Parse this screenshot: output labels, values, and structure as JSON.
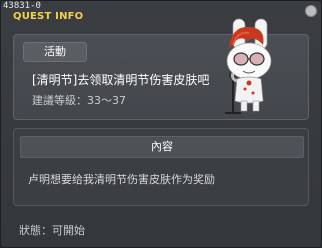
{
  "window": {
    "id_tag": "43831-0",
    "title": "QUEST INFO"
  },
  "quest": {
    "badge_label": "活動",
    "name": "[清明节]去领取清明节伤害皮肤吧",
    "level_range": "建議等級：33～37"
  },
  "content": {
    "header": "內容",
    "text": "卢明想要给我清明节伤害皮肤作为奖励"
  },
  "status_text": "狀態：可開始",
  "icons": {
    "close": "close-icon",
    "npc": "bunny-npc-portrait"
  },
  "colors": {
    "title": "#f2d24a",
    "panel": "#4b4f54",
    "text": "#ffffff"
  }
}
